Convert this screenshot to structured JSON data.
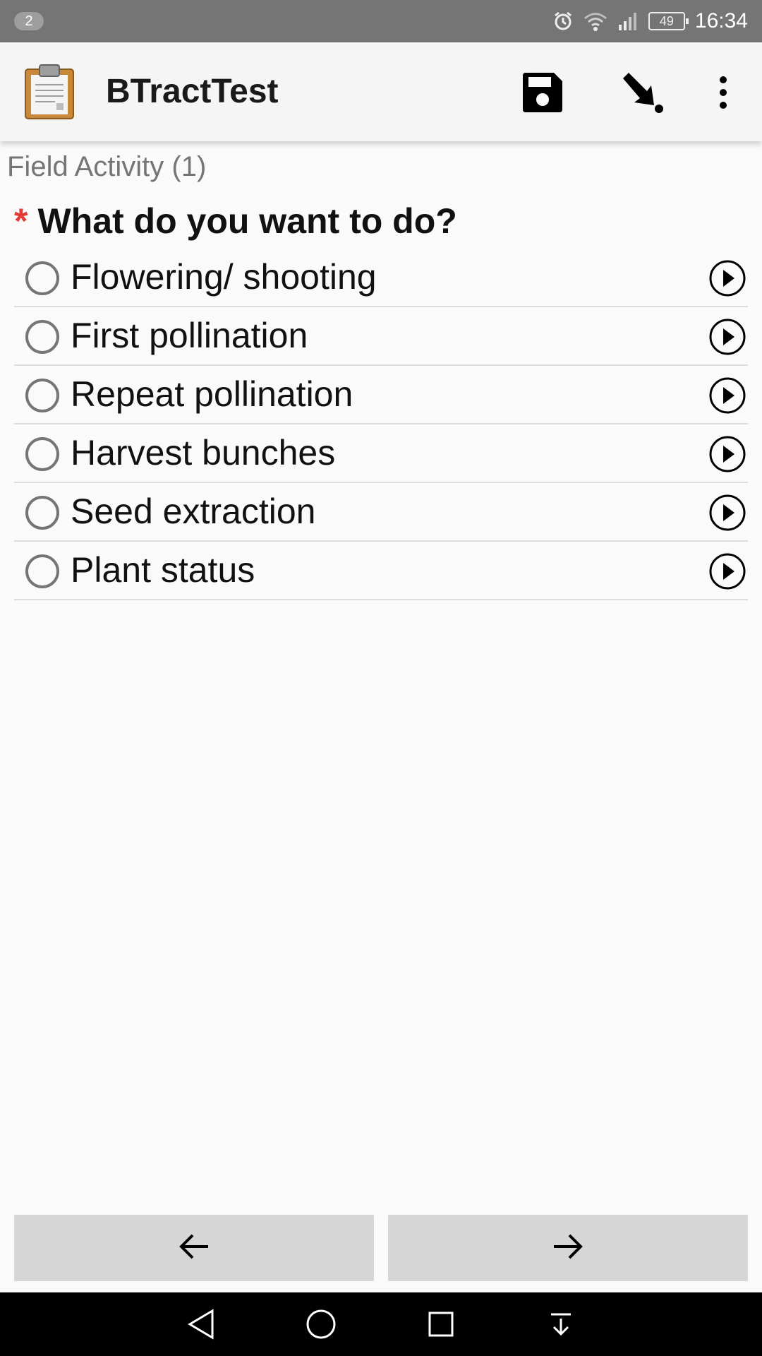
{
  "status_bar": {
    "notification_count": "2",
    "battery": "49",
    "time": "16:34",
    "icons": [
      "alarm-icon",
      "wifi-icon",
      "signal-icon",
      "battery-icon"
    ]
  },
  "app_bar": {
    "title": "BTractTest",
    "logo_icon": "clipboard-icon",
    "actions": [
      "save-icon",
      "jump-to-icon",
      "more-vert-icon"
    ]
  },
  "form": {
    "group_label": "Field Activity (1)",
    "required_marker": "*",
    "question": "What do you want to do?",
    "choices": [
      {
        "label": "Flowering/ shooting"
      },
      {
        "label": "First pollination"
      },
      {
        "label": "Repeat pollination"
      },
      {
        "label": "Harvest bunches"
      },
      {
        "label": "Seed extraction"
      },
      {
        "label": "Plant status"
      }
    ]
  },
  "navigation": {
    "back_icon": "arrow-left-icon",
    "next_icon": "arrow-right-icon"
  },
  "system_nav": [
    "back-triangle-icon",
    "home-circle-icon",
    "recents-square-icon",
    "notification-pull-icon"
  ],
  "colors": {
    "status_bar": "#757575",
    "app_bar": "#f5f5f5",
    "required": "#e53935",
    "nav_button": "#d6d6d6"
  }
}
